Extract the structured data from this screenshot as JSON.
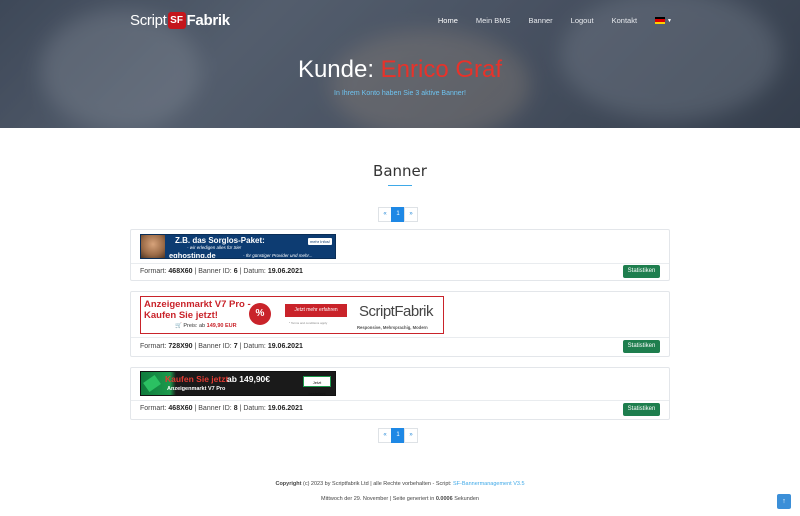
{
  "nav": {
    "brand_left": "Script",
    "brand_box": "SF",
    "brand_right": "Fabrik",
    "items": [
      {
        "label": "Home",
        "active": true
      },
      {
        "label": "Mein BMS",
        "active": false
      },
      {
        "label": "Banner",
        "active": false
      },
      {
        "label": "Logout",
        "active": false
      },
      {
        "label": "Kontakt",
        "active": false
      }
    ],
    "language_flag": "flag-de-icon"
  },
  "hero": {
    "title_prefix": "Kunde: ",
    "customer_name": "Enrico Graf",
    "subtitle": "In Ihrem Konto haben Sie 3 aktive Banner!"
  },
  "section": {
    "title": "Banner"
  },
  "pagination": {
    "prev": "«",
    "current": "1",
    "next": "»"
  },
  "banners": [
    {
      "format_label": "Formart:",
      "format": "468X60",
      "id_label": "Banner ID:",
      "id": "6",
      "date_label": "Datum:",
      "date": "19.06.2021",
      "stats_label": "Statistiken",
      "ad": {
        "headline": "Z.B. das Sorglos-Paket:",
        "tagline": "- wir erledigen alles für Sie!",
        "domain": "eghosting.de",
        "claim": "- Ihr günstiger Provider und mehr...",
        "button": "mehr Infos!"
      }
    },
    {
      "format_label": "Formart:",
      "format": "728X90",
      "id_label": "Banner ID:",
      "id": "7",
      "date_label": "Datum:",
      "date": "19.06.2021",
      "stats_label": "Statistiken",
      "ad": {
        "headline_1": "Anzeigenmarkt V7 Pro -",
        "headline_2": "Kaufen Sie jetzt!",
        "price_label": "Preis: ab",
        "price": "149,90 EUR",
        "percent": "%",
        "button": "Jetzt mehr erfahren",
        "terms": "* Terms and conditions apply",
        "logo": "ScriptFabrik",
        "claim": "Responsive, Mehrsprachig, Modern"
      }
    },
    {
      "format_label": "Formart:",
      "format": "468X60",
      "id_label": "Banner ID:",
      "id": "8",
      "date_label": "Datum:",
      "date": "19.06.2021",
      "stats_label": "Statistiken",
      "ad": {
        "headline": "Kaufen Sie jetzt",
        "price": "ab 149,90€",
        "product": "Anzeigenmarkt V7 Pro",
        "button": "Jetzt bestellen!"
      }
    }
  ],
  "footer": {
    "copyright_bold": "Copyright",
    "copyright_text": " (c) 2023 by Scriptfabrik Ltd | alle Rechte vorbehalten - Script: ",
    "script_link": "SF-Bannermanagement V3.5",
    "generated_prefix": "Mittwoch der 29. November | Seite generiert in ",
    "generated_time": "0.0006",
    "generated_suffix": " Sekunden",
    "to_top": "↑"
  },
  "colors": {
    "accent_blue": "#1e88e5",
    "stats_green": "#1e7e4e",
    "name_red": "#e8322a"
  }
}
